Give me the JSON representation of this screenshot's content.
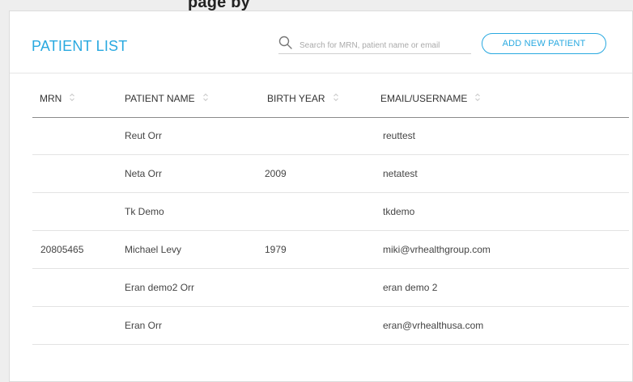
{
  "page_banner": "page by",
  "header": {
    "title": "PATIENT LIST",
    "search_placeholder": "Search for MRN, patient name or email",
    "add_button_label": "ADD NEW PATIENT"
  },
  "table": {
    "columns": [
      "MRN",
      "PATIENT NAME",
      "BIRTH YEAR",
      "EMAIL/USERNAME"
    ],
    "rows": [
      {
        "mrn": "",
        "name": "Reut Orr",
        "birth_year": "",
        "email": "reuttest"
      },
      {
        "mrn": "",
        "name": "Neta Orr",
        "birth_year": "2009",
        "email": "netatest"
      },
      {
        "mrn": "",
        "name": "Tk Demo",
        "birth_year": "",
        "email": "tkdemo"
      },
      {
        "mrn": "20805465",
        "name": "Michael Levy",
        "birth_year": "1979",
        "email": "miki@vrhealthgroup.com"
      },
      {
        "mrn": "",
        "name": "Eran demo2 Orr",
        "birth_year": "",
        "email": "eran demo 2"
      },
      {
        "mrn": "",
        "name": "Eran Orr",
        "birth_year": "",
        "email": "eran@vrhealthusa.com"
      }
    ]
  },
  "colors": {
    "accent": "#29a9e0",
    "background": "#eeeeee",
    "card": "#ffffff"
  },
  "icons": {
    "search": "search-icon",
    "sort": "sort-icon"
  }
}
